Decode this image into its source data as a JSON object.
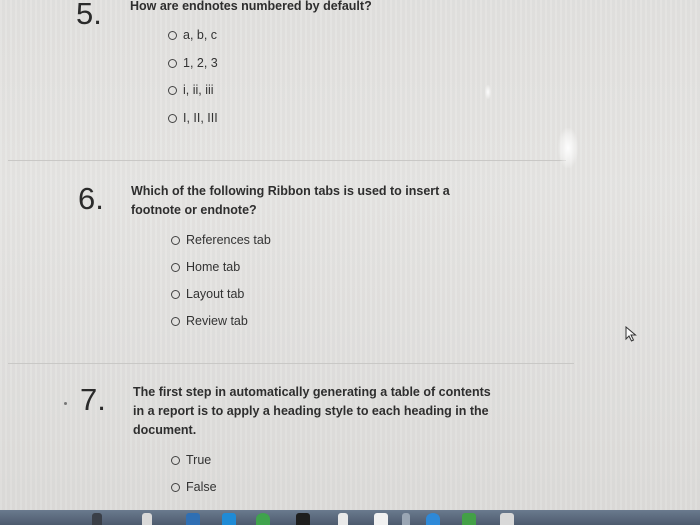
{
  "questions": [
    {
      "number": "5.",
      "text": "How are endnotes numbered by default?",
      "options": [
        "a, b, c",
        "1, 2, 3",
        "i, ii, iii",
        "I, II, III"
      ]
    },
    {
      "number": "6.",
      "text_line1": "Which of the following Ribbon tabs is used to insert a",
      "text_line2": "footnote or endnote?",
      "options": [
        "References tab",
        "Home tab",
        "Layout tab",
        "Review tab"
      ]
    },
    {
      "number": "7.",
      "text_line1": "The first step in automatically generating a table of contents",
      "text_line2": "in a report is to apply a heading style to each heading in the",
      "text_line3": "document.",
      "options": [
        "True",
        "False"
      ]
    }
  ],
  "colors": {
    "background": "#e4e3e1",
    "text": "#2e2e2e",
    "divider": "#c9c8c6",
    "taskbar": "#56657a"
  }
}
